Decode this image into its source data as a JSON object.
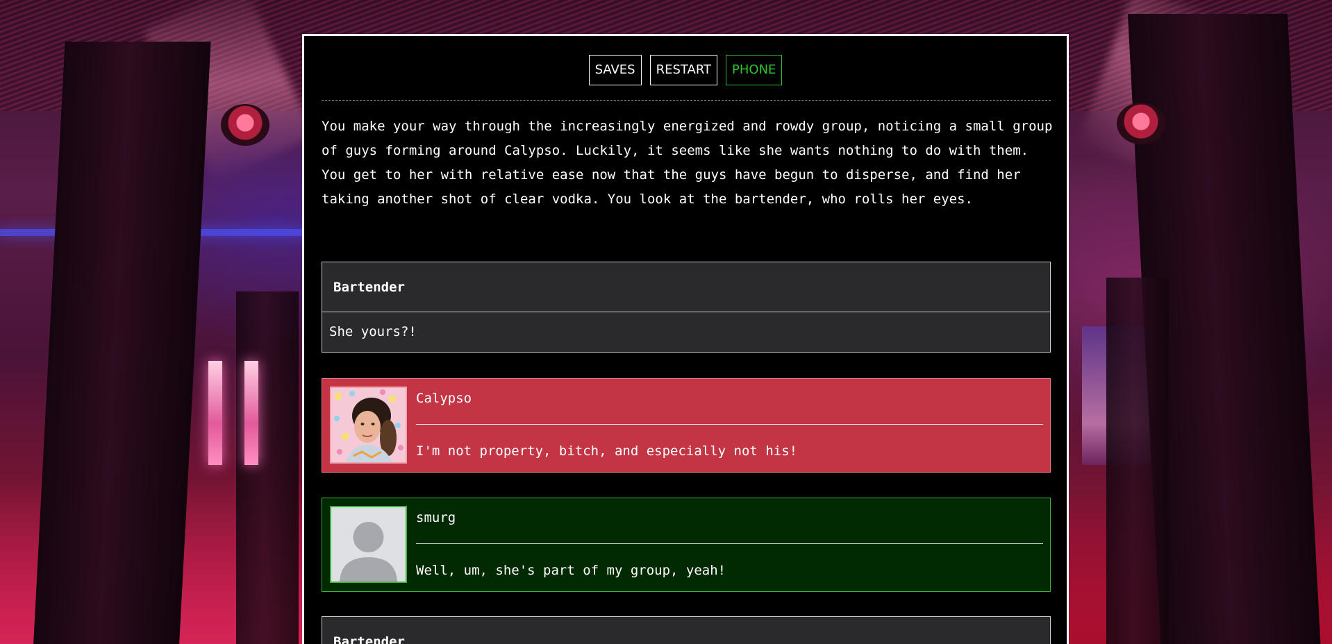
{
  "toolbar": {
    "saves_label": "SAVES",
    "restart_label": "RESTART",
    "phone_label": "PHONE"
  },
  "narration": "You make your way through the increasingly energized and rowdy group, noticing a small group of guys forming around Calypso. Luckily, it seems like she wants nothing to do with them. You get to her with relative ease now that the guys have begun to disperse, and find her taking another shot of clear vodka. You look at the bartender, who rolls her eyes.",
  "dialogue": {
    "bartender_1": {
      "speaker": "Bartender",
      "line": "She yours?!"
    },
    "calypso": {
      "speaker": "Calypso",
      "line": "I'm not property, bitch, and especially not his!"
    },
    "smurg": {
      "speaker": "smurg",
      "line": "Well, um, she's part of my group, yeah!"
    },
    "bartender_2": {
      "speaker": "Bartender"
    }
  },
  "colors": {
    "calypso_bg": "#c33544",
    "smurg_bg": "#012a00",
    "phone_accent": "#2fc42f",
    "npc_bg": "#2a292c"
  },
  "icons": {
    "calypso_avatar": "calypso-portrait",
    "smurg_avatar": "default-user-silhouette"
  }
}
